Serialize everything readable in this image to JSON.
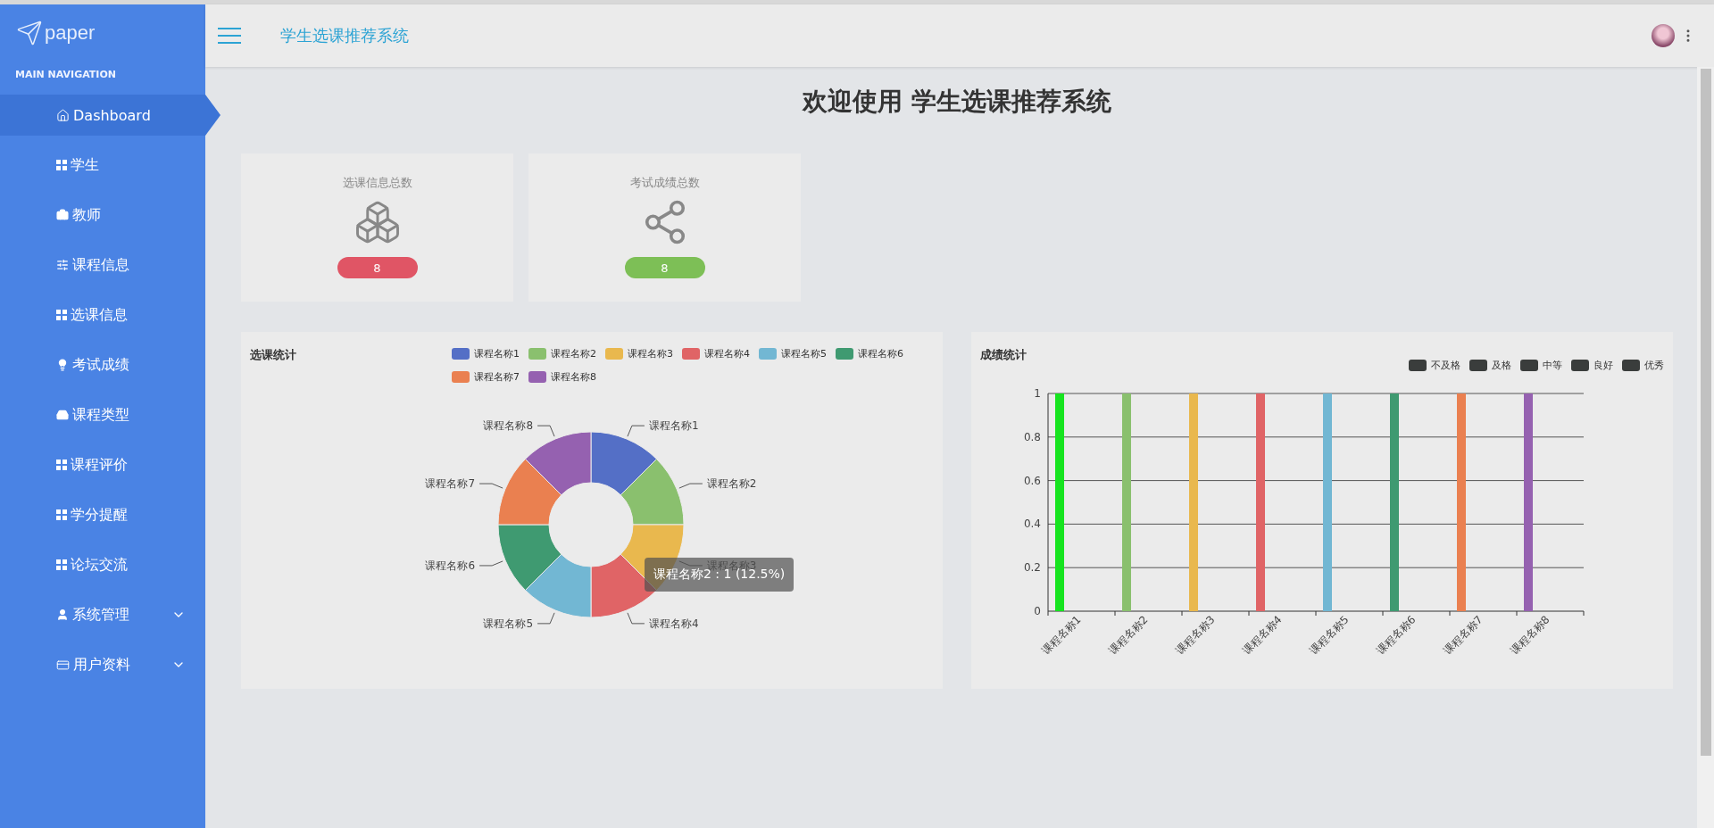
{
  "sidebar": {
    "logo": "paper",
    "section_title": "MAIN NAVIGATION",
    "items": [
      {
        "label": "Dashboard",
        "kind": "link",
        "selected": true
      },
      {
        "label": "学生",
        "kind": "link",
        "selected": false
      },
      {
        "label": "教师",
        "kind": "link",
        "selected": false
      },
      {
        "label": "课程信息",
        "kind": "link",
        "selected": false
      },
      {
        "label": "选课信息",
        "kind": "link",
        "selected": false
      },
      {
        "label": "考试成绩",
        "kind": "link",
        "selected": false
      },
      {
        "label": "课程类型",
        "kind": "link",
        "selected": false
      },
      {
        "label": "课程评价",
        "kind": "link",
        "selected": false
      },
      {
        "label": "学分提醒",
        "kind": "link",
        "selected": false
      },
      {
        "label": "论坛交流",
        "kind": "link",
        "selected": false
      },
      {
        "label": "系统管理",
        "kind": "group",
        "selected": false
      },
      {
        "label": "用户资料",
        "kind": "group",
        "selected": false
      }
    ]
  },
  "header": {
    "title": "学生选课推荐系统"
  },
  "page_title": "欢迎使用 学生选课推荐系统",
  "stat_cards": [
    {
      "label": "选课信息总数",
      "count": "8",
      "color": "#e05565"
    },
    {
      "label": "考试成绩总数",
      "count": "8",
      "color": "#7dbf56"
    }
  ],
  "pie_panel": {
    "title": "选课统计",
    "tooltip": "课程名称2 : 1 (12.5%)",
    "chart_data": {
      "type": "donut",
      "categories": [
        "课程名称1",
        "课程名称2",
        "课程名称3",
        "课程名称4",
        "课程名称5",
        "课程名称6",
        "课程名称7",
        "课程名称8"
      ],
      "series": [
        {
          "values": [
            1,
            1,
            1,
            1,
            1,
            1,
            1,
            1
          ],
          "colors": [
            "#546fc6",
            "#8ac06e",
            "#e9b84e",
            "#e06466",
            "#72b7d3",
            "#3f9a71",
            "#ea8050",
            "#9561b0"
          ]
        }
      ]
    }
  },
  "bar_panel": {
    "title": "成绩统计",
    "chart_data": {
      "type": "bar",
      "grid": true,
      "categories": [
        "课程名称1",
        "课程名称2",
        "课程名称3",
        "课程名称4",
        "课程名称5",
        "课程名称6",
        "课程名称7",
        "课程名称8"
      ],
      "series": [
        {
          "name": "不及格",
          "color": "#3a3d3c",
          "values": [
            1,
            1,
            1,
            1,
            1,
            1,
            1,
            1
          ],
          "colors": [
            "#16e41f",
            "#8ac06e",
            "#e9b84e",
            "#e06466",
            "#72b7d3",
            "#3f9a71",
            "#ea8050",
            "#9561b0"
          ]
        },
        {
          "name": "及格",
          "color": "#3a3d3c",
          "values": [
            null,
            null,
            null,
            null,
            null,
            null,
            null,
            null
          ]
        },
        {
          "name": "中等",
          "color": "#3a3d3c",
          "values": [
            null,
            null,
            null,
            null,
            null,
            null,
            null,
            null
          ]
        },
        {
          "name": "良好",
          "color": "#3a3d3c",
          "values": [
            null,
            null,
            null,
            null,
            null,
            null,
            null,
            null
          ]
        },
        {
          "name": "优秀",
          "color": "#3a3d3c",
          "values": [
            null,
            null,
            null,
            null,
            null,
            null,
            null,
            null
          ]
        }
      ],
      "ylim": [
        0,
        1
      ],
      "yticks": [
        0,
        0.2,
        0.4,
        0.6,
        0.8,
        1
      ]
    }
  }
}
